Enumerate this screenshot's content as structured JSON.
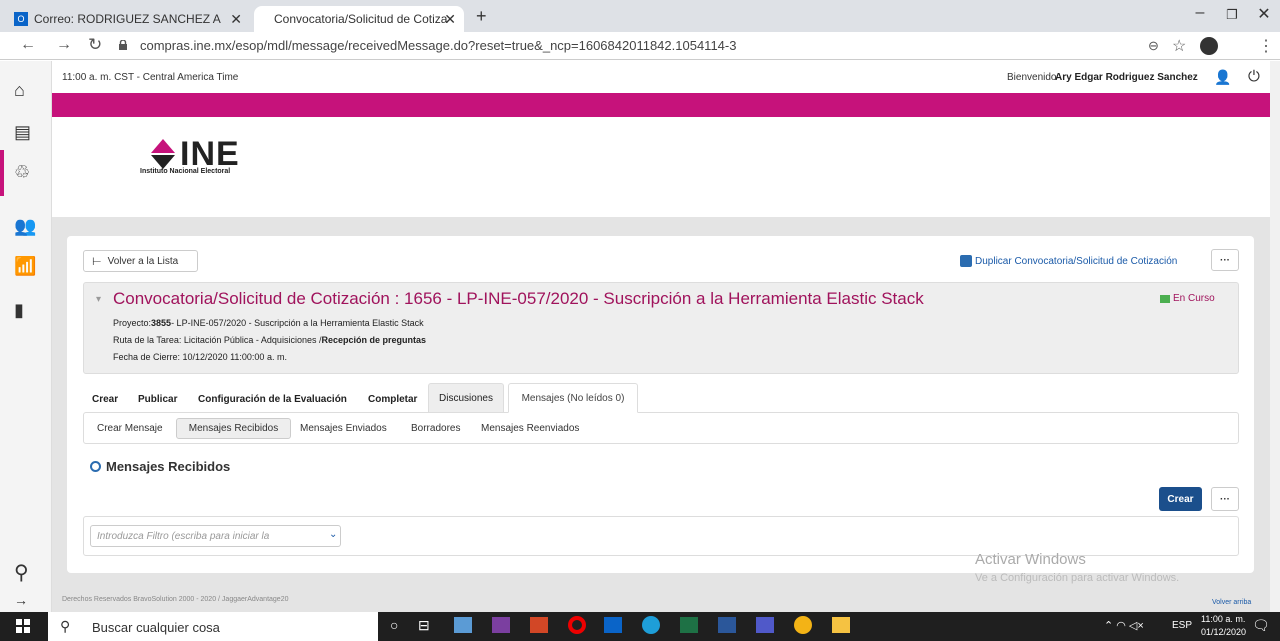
{
  "browser": {
    "tabs": [
      {
        "label": "Correo: RODRIGUEZ SANCHEZ A"
      },
      {
        "label": "Convocatoria/Solicitud de Cotiza"
      }
    ],
    "url": "compras.ine.mx/esop/mdl/message/receivedMessage.do?reset=true&_ncp=1606842011842.1054114-3"
  },
  "header": {
    "time": "11:00 a. m. CST - Central America Time",
    "welcome": "Bienvenido",
    "user": "Ary Edgar Rodriguez Sanchez"
  },
  "logo": {
    "text": "INE",
    "subtitle": "Instituto Nacional Electoral"
  },
  "toolbar": {
    "back_label": "Volver a la Lista",
    "duplicate_label": "Duplicar Convocatoria/Solicitud de Cotización",
    "more_label": "···"
  },
  "detail": {
    "title": "Convocatoria/Solicitud de Cotización : 1656 - LP-INE-057/2020 - Suscripción a la Herramienta Elastic Stack",
    "status": "En Curso",
    "project_label": "Proyecto:",
    "project_id": "3855",
    "project_rest": "- LP-INE-057/2020 - Suscripción a la Herramienta Elastic Stack",
    "route_label": "Ruta de la Tarea: Licitación Pública - Adquisiciones /",
    "route_bold": "Recepción de preguntas",
    "closing": "Fecha de Cierre: 10/12/2020 11:00:00 a. m."
  },
  "tabs": [
    "Crear",
    "Publicar",
    "Configuración de la Evaluación",
    "Completar",
    "Discusiones",
    "Mensajes (No leídos 0)"
  ],
  "subnav": [
    "Crear Mensaje",
    "Mensajes Recibidos",
    "Mensajes Enviados",
    "Borradores",
    "Mensajes Reenviados"
  ],
  "section": {
    "title": "Mensajes Recibidos",
    "create_label": "Crear",
    "more_label": "···",
    "filter_placeholder": "Introduzca Filtro (escriba para iniciar la"
  },
  "watermark": {
    "line1": "Activar Windows",
    "line2": "Ve a Configuración para activar Windows."
  },
  "footer": {
    "copyright": "Derechos Reservados BravoSolution 2000 - 2020 / JaggaerAdvantage20",
    "back_top": "Volver arriba"
  },
  "taskbar": {
    "search": "Buscar cualquier cosa",
    "lang": "ESP",
    "time": "11:00 a. m.",
    "date": "01/12/2020"
  }
}
